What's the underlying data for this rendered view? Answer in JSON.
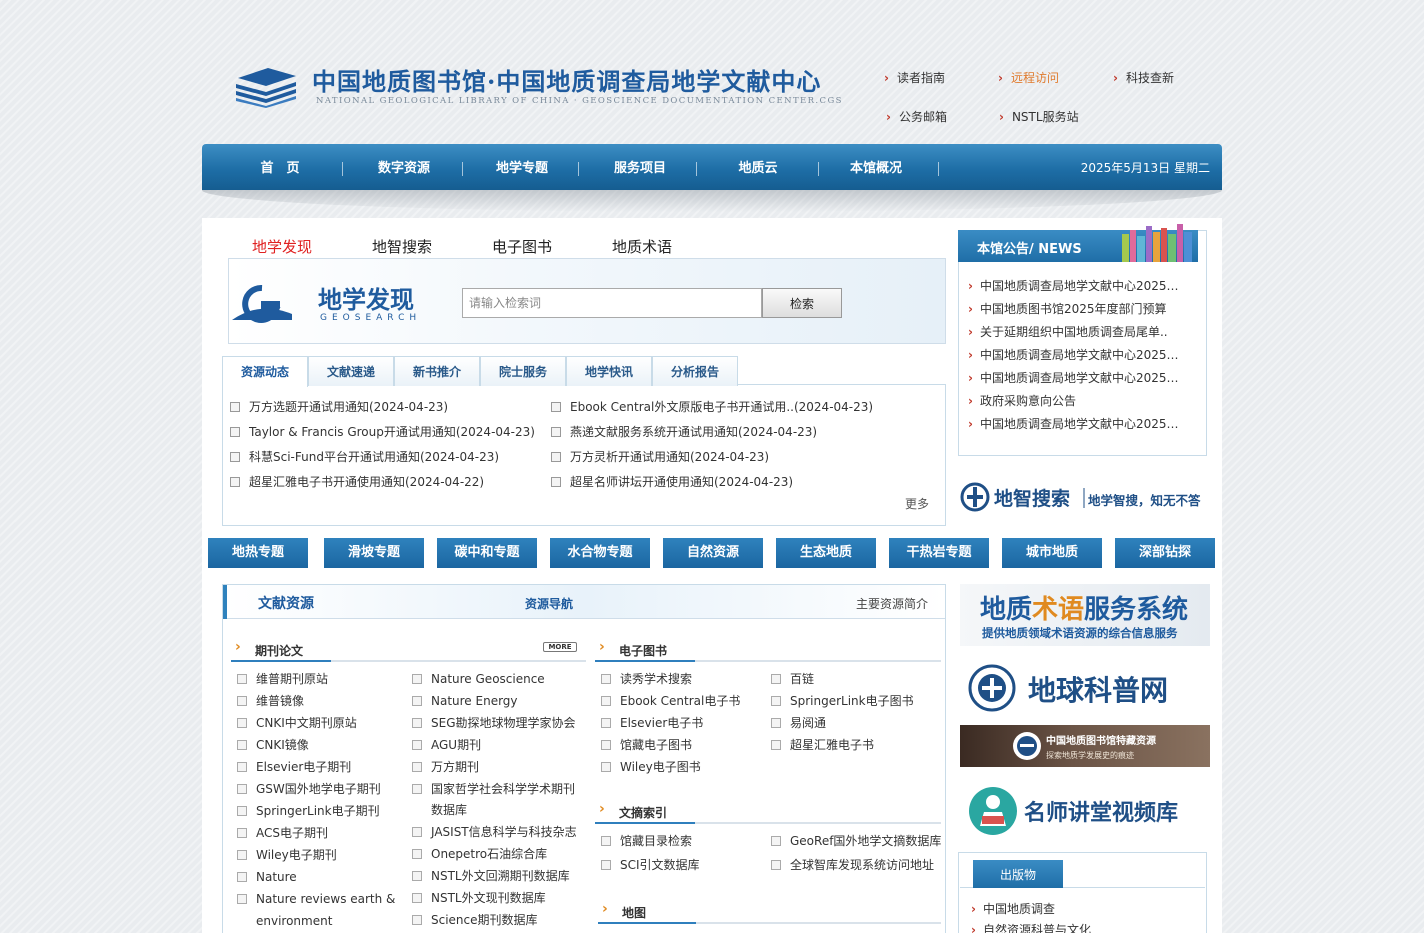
{
  "header": {
    "logo_cn": "中国地质图书馆·中国地质调查局地学文献中心",
    "logo_en": "NATIONAL GEOLOGICAL LIBRARY OF CHINA · GEOSCIENCE DOCUMENTATION CENTER.CGS",
    "links": [
      "读者指南",
      "远程访问",
      "科技查新",
      "公务邮箱",
      "NSTL服务站"
    ]
  },
  "nav": {
    "items": [
      "首　页",
      "数字资源",
      "地学专题",
      "服务项目",
      "地质云",
      "本馆概况"
    ],
    "date": "2025年5月13日 星期二"
  },
  "search": {
    "tabs": [
      "地学发现",
      "地智搜索",
      "电子图书",
      "地质术语"
    ],
    "logo_cn": "地学发现",
    "logo_en": "GEOSEARCH",
    "placeholder": "请输入检索词",
    "button": "检索"
  },
  "news": {
    "tabs": [
      "资源动态",
      "文献速递",
      "新书推介",
      "院士服务",
      "地学快讯",
      "分析报告"
    ],
    "left": [
      "万方选题开通试用通知(2024-04-23)",
      "Taylor & Francis Group开通试用通知(2024-04-23)",
      "科慧Sci-Fund平台开通试用通知(2024-04-23)",
      "超星汇雅电子书开通使用通知(2024-04-22)"
    ],
    "right": [
      "Ebook Central外文原版电子书开通试用..(2024-04-23)",
      "燕递文献服务系统开通试用通知(2024-04-23)",
      "万方灵析开通试用通知(2024-04-23)",
      "超星名师讲坛开通使用通知(2024-04-23)"
    ],
    "more": "更多"
  },
  "topics": [
    "地热专题",
    "滑坡专题",
    "碳中和专题",
    "水合物专题",
    "自然资源",
    "生态地质",
    "干热岩专题",
    "城市地质",
    "深部钻探"
  ],
  "resources": {
    "head_left": "文献资源",
    "head_center": "资源导航",
    "head_right": "主要资源简介",
    "more_badge": "MORE",
    "journals_title": "期刊论文",
    "journals_col1": [
      "维普期刊原站",
      "维普镜像",
      "CNKI中文期刊原站",
      "CNKI镜像",
      "Elsevier电子期刊",
      "GSW国外地学电子期刊",
      "SpringerLink电子期刊",
      "ACS电子期刊",
      "Wiley电子期刊",
      "Nature",
      "Nature reviews earth &",
      "environment"
    ],
    "journals_col2": [
      "Nature Geoscience",
      "Nature Energy",
      "SEG勘探地球物理学家协会",
      "AGU期刊",
      "万方期刊",
      "国家哲学社会科学学术期刊",
      "数据库",
      "JASIST信息科学与科技杂志",
      "Onepetro石油综合库",
      "NSTL外文回溯期刊数据库",
      "NSTL外文现刊数据库",
      "Science期刊数据库"
    ],
    "ebooks_title": "电子图书",
    "ebooks_col1": [
      "读秀学术搜索",
      "Ebook Central电子书",
      "Elsevier电子书",
      "馆藏电子图书",
      "Wiley电子图书"
    ],
    "ebooks_col2": [
      "百链",
      "SpringerLink电子图书",
      "易阅通",
      "超星汇雅电子书"
    ],
    "index_title": "文摘索引",
    "index_col1": [
      "馆藏目录检索",
      "SCI引文数据库"
    ],
    "index_col2": [
      "GeoRef国外地学文摘数据库",
      "全球智库发现系统访问地址"
    ],
    "map_title": "地图"
  },
  "notices": {
    "title": "本馆公告/ NEWS",
    "items": [
      "中国地质调查局地学文献中心2025年..",
      "中国地质图书馆2025年度部门预算",
      "关于延期组织中国地质调查局尾单..",
      "中国地质调查局地学文献中心2025年..",
      "中国地质调查局地学文献中心2025年..",
      "政府采购意向公告",
      "中国地质调查局地学文献中心2025年.."
    ]
  },
  "banners": {
    "dizhi_title": "地智搜索",
    "dizhi_slogan": "地学智搜，知无不答",
    "terms_title_a": "地质",
    "terms_title_b": "术语",
    "terms_title_c": "服务系统",
    "terms_sub": "提供地质领域术语资源的综合信息服务",
    "earth_title": "地球科普网",
    "special_title": "中国地质图书馆特藏资源",
    "special_sub": "探索地质学发展史的痕迹",
    "lecture_title": "名师讲堂视频库"
  },
  "publications": {
    "title": "出版物",
    "items": [
      "中国地质调查",
      "自然资源科普与文化"
    ]
  },
  "colors": {
    "brand_blue": "#1f5b9e",
    "nav_blue": "#1e6ea6",
    "accent_red": "#e02020",
    "accent_orange": "#e07b2e"
  }
}
